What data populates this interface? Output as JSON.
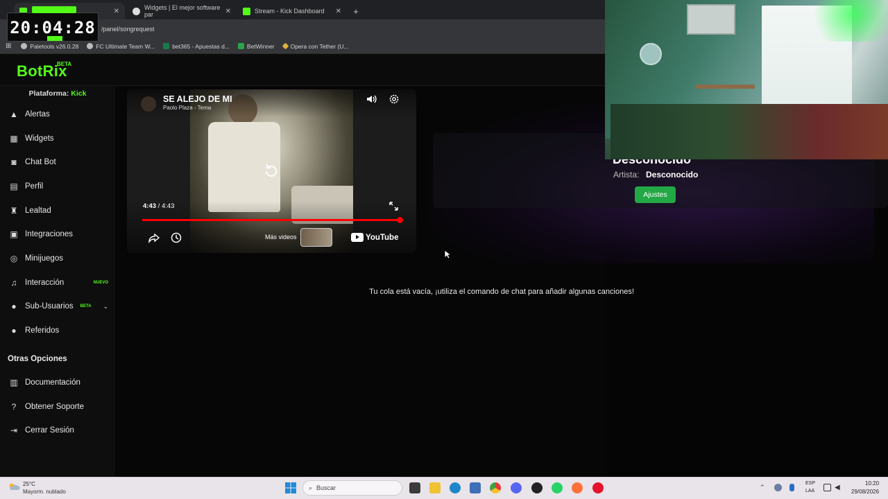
{
  "browser": {
    "tabs": [
      {
        "label": "Widgets | El mejor software par"
      },
      {
        "label": "Stream - Kick Dashboard"
      }
    ],
    "new_tab": "+",
    "url": "/panel/songrequest",
    "bookmarks": [
      {
        "label": "Paletools v26.0.28"
      },
      {
        "label": "FC Ultimate Team W..."
      },
      {
        "label": "bet365 - Apuestas d..."
      },
      {
        "label": "BetWinner"
      },
      {
        "label": "Opera con Tether (U..."
      }
    ]
  },
  "overlay_clock": {
    "time": "20:04:28"
  },
  "app": {
    "logo": "BotRix",
    "logo_badge": "BETA"
  },
  "sidebar": {
    "platform_label": "Plataforma:",
    "platform_value": "Kick",
    "items": [
      {
        "label": "Alertas",
        "icon": "warning-icon"
      },
      {
        "label": "Widgets",
        "icon": "grid-icon"
      },
      {
        "label": "Chat Bot",
        "icon": "robot-icon"
      },
      {
        "label": "Perfil",
        "icon": "id-card-icon"
      },
      {
        "label": "Lealtad",
        "icon": "trophy-icon"
      },
      {
        "label": "Integraciones",
        "icon": "plugin-icon"
      },
      {
        "label": "Minijuegos",
        "icon": "gamepad-icon"
      },
      {
        "label": "Interacción",
        "icon": "music-icon",
        "badge": "NUEVO"
      },
      {
        "label": "Sub-Usuarios",
        "icon": "users-icon",
        "badge": "BETA"
      },
      {
        "label": "Referidos",
        "icon": "user-plus-icon"
      }
    ],
    "section_other": "Otras Opciones",
    "other_items": [
      {
        "label": "Documentación",
        "icon": "book-icon"
      },
      {
        "label": "Obtener Soporte",
        "icon": "help-icon"
      },
      {
        "label": "Cerrar Sesión",
        "icon": "logout-icon"
      }
    ]
  },
  "player": {
    "title": "SE ALEJO DE MI",
    "subtitle": "Paolo Plaza - Tema",
    "time_current": "4:43",
    "time_total": "4:43",
    "time_sep": " / ",
    "progress_fraction": 1.0,
    "more_videos": "Más videos",
    "brand": "YouTube"
  },
  "song_info": {
    "title": "Desconocido",
    "artist_label": "Artista:",
    "artist_value": "Desconocido",
    "settings_button": "Ajustes"
  },
  "queue": {
    "empty_message": "Tu cola está vacía, ¡utiliza el comando de chat para añadir algunas canciones!"
  },
  "taskbar": {
    "weather_temp": "25°C",
    "weather_desc": "Mayorm. nublado",
    "search_placeholder": "Buscar",
    "lang_top": "ESP",
    "lang_bottom": "LAA",
    "time": "10:20",
    "date": "29/08/2026"
  },
  "colors": {
    "brand_green": "#53fc18",
    "button_green": "#22a845",
    "progress_red": "#ff0000"
  }
}
